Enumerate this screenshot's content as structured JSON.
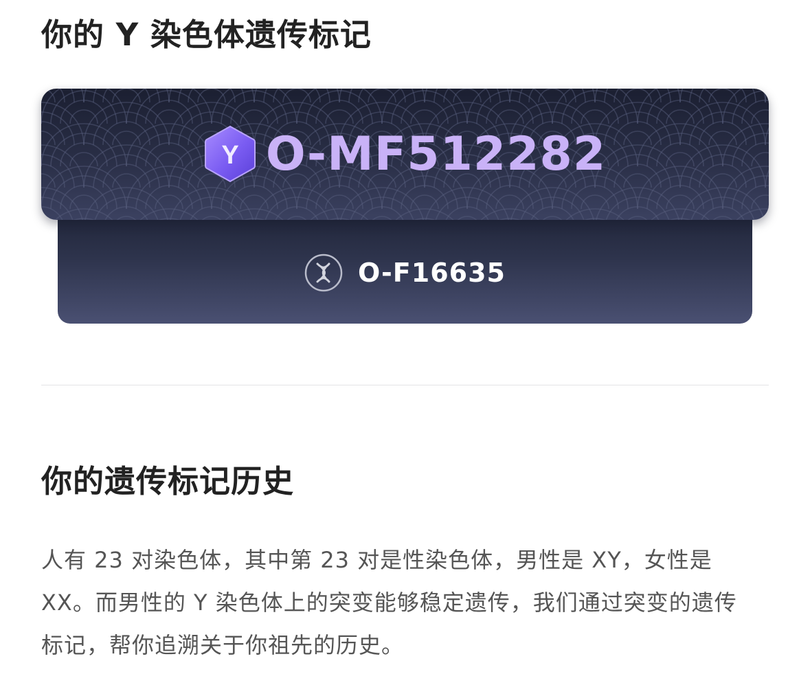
{
  "y_marker_section": {
    "title": "你的 Y 染色体遗传标记",
    "main_haplogroup": {
      "badge_letter": "Y",
      "badge_icon": "y-chromosome-hexagon-icon",
      "code": "O-MF512282"
    },
    "sub_haplogroup": {
      "icon": "chromosome-x-circle-icon",
      "code": "O-F16635"
    }
  },
  "history_section": {
    "title": "你的遗传标记历史",
    "description": "人有 23 对染色体，其中第 23 对是性染色体，男性是 XY，女性是 XX。而男性的 Y 染色体上的突变能够稳定遗传，我们通过突变的遗传标记，帮你追溯关于你祖先的历史。"
  },
  "colors": {
    "card_dark": "#1b1f31",
    "card_light": "#4a5072",
    "main_code": "#c9b2f7",
    "badge_purple": "#7b5cf0",
    "sub_code": "#ffffff"
  }
}
